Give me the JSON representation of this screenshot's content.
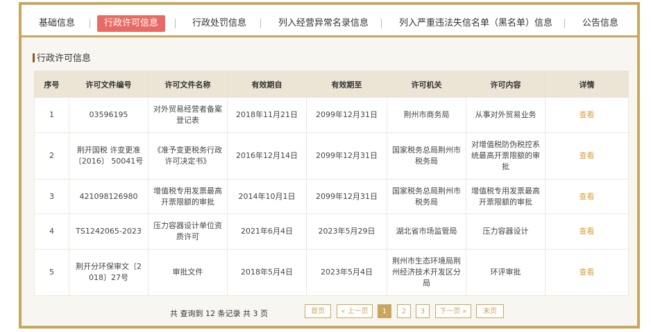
{
  "tabs": [
    {
      "label": "基础信息",
      "active": false
    },
    {
      "label": "行政许可信息",
      "active": true
    },
    {
      "label": "行政处罚信息",
      "active": false
    },
    {
      "label": "列入经营异常名录信息",
      "active": false
    },
    {
      "label": "列入严重违法失信名单（黑名单）信息",
      "active": false
    },
    {
      "label": "公告信息",
      "active": false
    }
  ],
  "section_title": "行政许可信息",
  "table": {
    "headers": [
      "序号",
      "许可文件编号",
      "许可文件名称",
      "有效期自",
      "有效期至",
      "许可机关",
      "许可内容",
      "详情"
    ],
    "rows": [
      {
        "no": "1",
        "doc_no": "03596195",
        "doc_name": "对外贸易经营者备案登记表",
        "from": "2018年11月21日",
        "to": "2099年12月31日",
        "authority": "荆州市商务局",
        "content": "从事对外贸易业务",
        "detail": "查看"
      },
      {
        "no": "2",
        "doc_no": "荆开国税 许变更准〔2016〕 50041号",
        "doc_name": "《准予变更税务行政许可决定书》",
        "from": "2016年12月14日",
        "to": "2099年12月31日",
        "authority": "国家税务总局荆州市税务局",
        "content": "对增值税防伪税控系统最高开票限额的审批",
        "detail": "查看"
      },
      {
        "no": "3",
        "doc_no": "421098126980",
        "doc_name": "增值税专用发票最高开票限额的审批",
        "from": "2014年10月1日",
        "to": "2099年12月31日",
        "authority": "国家税务总局荆州市税务局",
        "content": "增值税专用发票最高开票限额的审批",
        "detail": "查看"
      },
      {
        "no": "4",
        "doc_no": "TS1242065-2023",
        "doc_name": "压力容器设计单位资质许可",
        "from": "2021年6月4日",
        "to": "2023年5月29日",
        "authority": "湖北省市场监管局",
        "content": "压力容器设计",
        "detail": "查看"
      },
      {
        "no": "5",
        "doc_no": "荆开分环保审文〔2018〕27号",
        "doc_name": "审批文件",
        "from": "2018年5月4日",
        "to": "2023年5月4日",
        "authority": "荆州市生态环境局荆州经济技术开发区分局",
        "content": "环评审批",
        "detail": "查看"
      }
    ]
  },
  "pagination": {
    "summary": "共 查询到 12 条记录 共 3 页",
    "first": "首页",
    "prev": "« 上一页",
    "pages": [
      "1",
      "2",
      "3"
    ],
    "current": "1",
    "next": "下一页 »",
    "last": "末页"
  },
  "colors": {
    "accent": "#c9a65d",
    "active_tab": "#e86a64",
    "header_bg": "#ece5d6",
    "link": "#d9a23a"
  }
}
